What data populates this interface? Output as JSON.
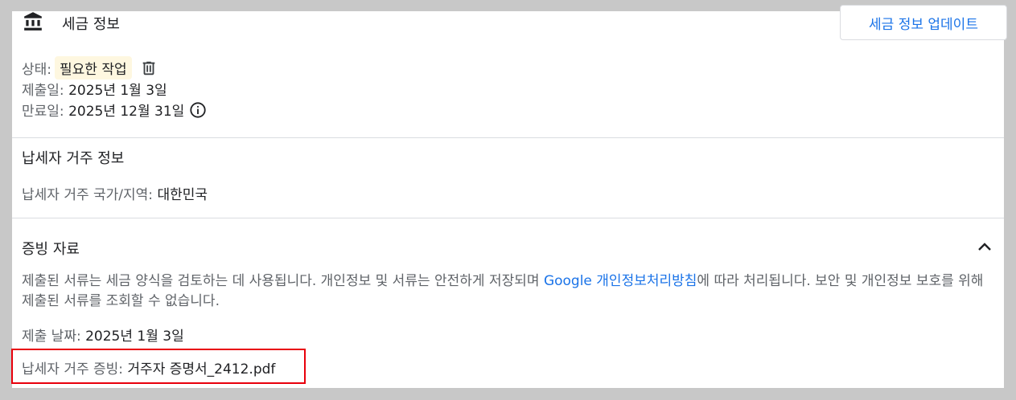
{
  "header": {
    "title": "세금 정보",
    "icon": "bank-icon",
    "update_button": "세금 정보 업데이트"
  },
  "status": {
    "status_label": "상태:",
    "status_value": "필요한 작업",
    "submitted_label": "제출일:",
    "submitted_value": "2025년 1월 3일",
    "expiry_label": "만료일:",
    "expiry_value": "2025년 12월 31일"
  },
  "residency": {
    "section_title": "납세자 거주 정보",
    "country_label": "납세자 거주 국가/지역:",
    "country_value": "대한민국"
  },
  "documents": {
    "section_title": "증빙 자료",
    "desc_part1": "제출된 서류는 세금 양식을 검토하는 데 사용됩니다. 개인정보 및 서류는 안전하게 저장되며 ",
    "desc_link": "Google 개인정보처리방침",
    "desc_part2": "에 따라 처리됩니다. 보안 및 개인정보 보호를 위해 제출된 서류를 조회할 수 없습니다.",
    "date_label": "제출 날짜:",
    "date_value": "2025년 1월 3일",
    "proof_label": "납세자 거주 증빙:",
    "proof_value": "거주자 증명서_2412.pdf"
  },
  "colors": {
    "accent": "#1a73e8",
    "badge_bg": "#fef7e0",
    "highlight": "#e8000b"
  }
}
